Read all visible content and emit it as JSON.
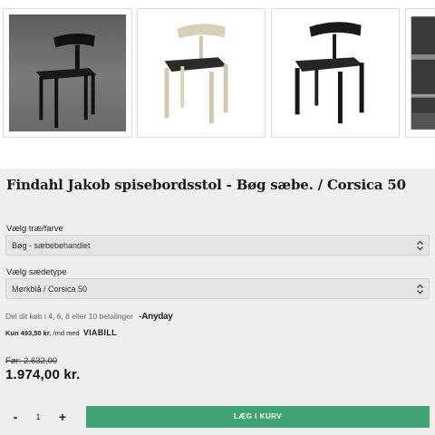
{
  "product": {
    "title": "Findahl Jakob spisebordsstol - Bøg sæbe. / Corsica 50"
  },
  "options": {
    "wood": {
      "label": "Vælg træ/farve",
      "value": "Bøg - sæbebehandlet"
    },
    "seat": {
      "label": "Vælg sædetype",
      "value": "Mørkblå / Corsica 50"
    }
  },
  "financing": {
    "anyday_text": "Del dit køb i 4, 6, 8 eller 10 betalinger",
    "anyday_logo": "Anyday",
    "viabill_amount": "Kun 493,50 kr.",
    "viabill_suffix": "/md med",
    "viabill_logo": "VIABILL"
  },
  "pricing": {
    "old_price": "Før: 2.632,00",
    "price": "1.974,00 kr."
  },
  "cart": {
    "minus": "-",
    "quantity": "1",
    "plus": "+",
    "add_label": "LÆG I KURV"
  },
  "colors": {
    "panel_bg": "#efefef",
    "cart_button": "#3fa372"
  },
  "icons": [
    "chair-photo-dark",
    "chair-photo-oak",
    "chair-photo-black",
    "chair-photo-partial",
    "select-chevron-icon"
  ]
}
